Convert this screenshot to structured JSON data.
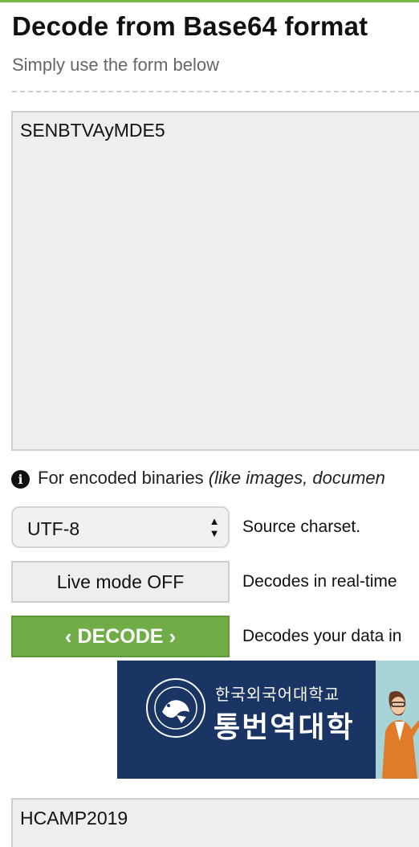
{
  "header": {
    "title": "Decode from Base64 format",
    "subtitle": "Simply use the form below"
  },
  "input": {
    "value": "SENBTVAyMDE5"
  },
  "notice": {
    "text": "For encoded binaries ",
    "italic": "(like images, documen",
    "icon": "info-icon"
  },
  "charset": {
    "selected": "UTF-8",
    "description": "Source charset."
  },
  "live_mode": {
    "label": "Live mode OFF",
    "description": "Decodes in real-time"
  },
  "decode": {
    "label": "DECODE",
    "description": "Decodes your data in"
  },
  "ad": {
    "line1": "한국외국어대학교",
    "line2": "통번역대학",
    "seal_text": "Hankuk University of Foreign Studies"
  },
  "output": {
    "value": "HCAMP2019"
  },
  "colors": {
    "accent": "#70ad47",
    "ad_background": "#1a3463",
    "field_background": "#eeeeee"
  }
}
